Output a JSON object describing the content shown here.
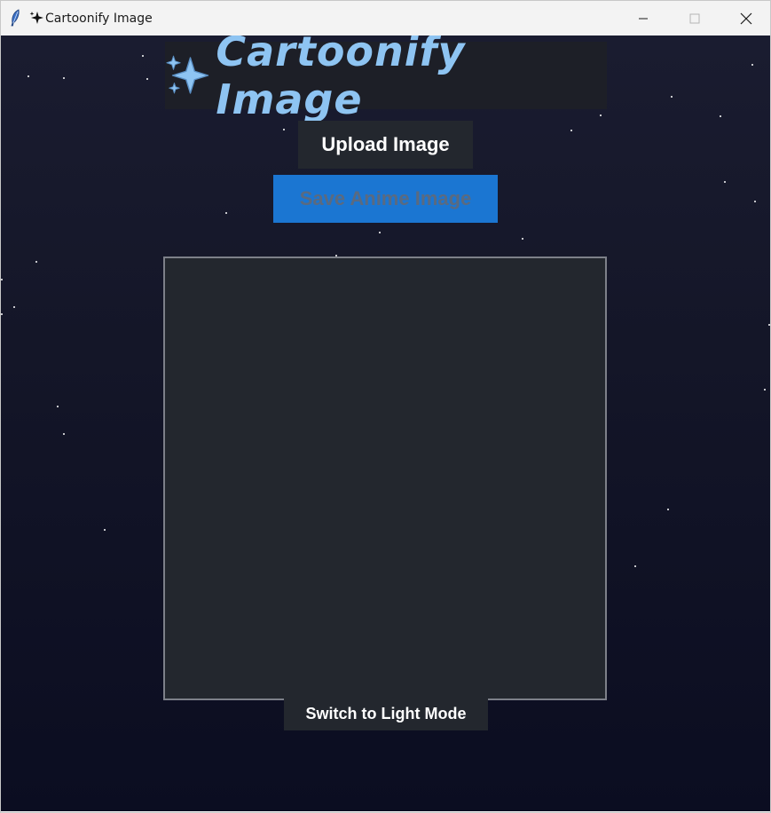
{
  "window": {
    "title": "Cartoonify Image",
    "title_icon": "sparkles-icon",
    "app_icon": "feather-icon",
    "controls": {
      "minimize_icon": "minimize-icon",
      "maximize_icon": "maximize-icon",
      "close_icon": "close-icon"
    }
  },
  "app": {
    "heading": "Cartoonify Image",
    "heading_icon": "sparkles-icon",
    "upload_label": "Upload Image",
    "save_label": "Save Anime Image",
    "theme_toggle_label": "Switch to Light Mode",
    "image_preview_empty": true
  },
  "colors": {
    "background_top": "#1a1c30",
    "background_bottom": "#0b0d21",
    "heading_text": "#8ec4f2",
    "heading_bg": "#1d1f27",
    "button_dark": "#23272e",
    "button_save": "#1b76d2",
    "save_text_disabled": "#5a6a80",
    "panel_border": "#7d8089",
    "sparkle": "#8ec4f2"
  }
}
